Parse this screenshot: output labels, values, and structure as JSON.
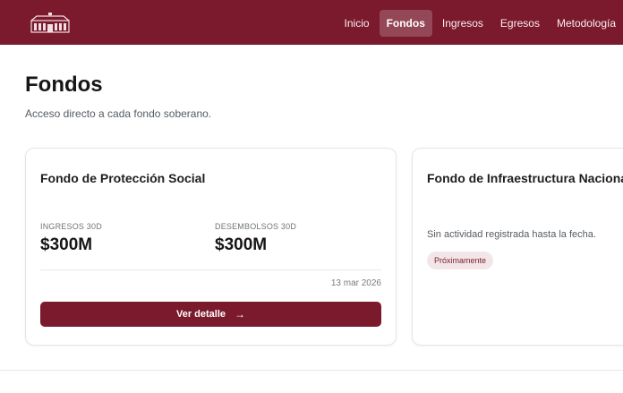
{
  "header": {
    "logo_icon": "building-logo-icon",
    "brand_color": "#7a1a2c",
    "nav": [
      {
        "label": "Inicio",
        "active": false
      },
      {
        "label": "Fondos",
        "active": true
      },
      {
        "label": "Ingresos",
        "active": false
      },
      {
        "label": "Egresos",
        "active": false
      },
      {
        "label": "Metodología",
        "active": false
      }
    ]
  },
  "page": {
    "title": "Fondos",
    "subtitle": "Acceso directo a cada fondo soberano."
  },
  "funds": [
    {
      "title": "Fondo de Protección Social",
      "stats": [
        {
          "label": "INGRESOS 30D",
          "value": "$300M"
        },
        {
          "label": "DESEMBOLSOS 30D",
          "value": "$300M"
        }
      ],
      "date": "13 mar 2026",
      "button_label": "Ver detalle",
      "button_icon": "arrow-right-icon"
    },
    {
      "title": "Fondo de Infraestructura Nacional",
      "empty_text": "Sin actividad registrada hasta la fecha.",
      "badge": "Próximamente"
    }
  ]
}
